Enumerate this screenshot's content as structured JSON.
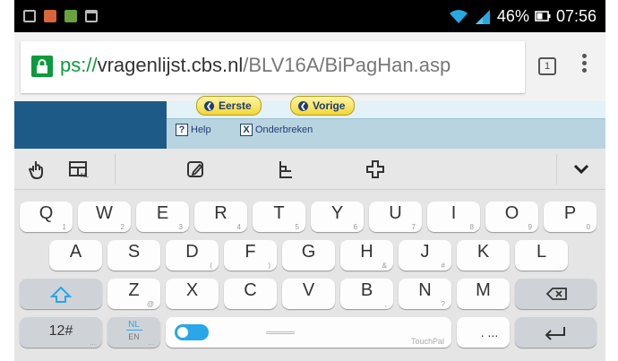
{
  "status_bar": {
    "battery_percent": "46%",
    "time": "07:56",
    "notification_icons": [
      "square-outline-icon",
      "app-orange-icon",
      "app-green-icon",
      "clipboard-icon"
    ]
  },
  "browser": {
    "url_scheme": "ps://",
    "url_host": "vragenlijst.cbs.nl",
    "url_path": "/BLV16A/BiPagHan.asp",
    "tab_count": "1"
  },
  "web": {
    "nav_buttons": [
      {
        "label": "Eerste"
      },
      {
        "label": "Vorige"
      }
    ],
    "links": [
      {
        "icon_text": "?",
        "label": "Help"
      },
      {
        "icon_text": "X",
        "label": "Onderbreken"
      }
    ]
  },
  "keyboard": {
    "toolbar_icons": [
      "touch-gesture-icon",
      "keyboard-layout-icon",
      "edit-icon",
      "cursor-select-icon",
      "move-icon",
      "collapse-chevron-icon"
    ],
    "layout_badge": "NL",
    "row1": [
      {
        "ch": "Q",
        "hint": "1"
      },
      {
        "ch": "W",
        "hint": "2"
      },
      {
        "ch": "E",
        "hint": "3"
      },
      {
        "ch": "R",
        "hint": "4"
      },
      {
        "ch": "T",
        "hint": "5"
      },
      {
        "ch": "Y",
        "hint": "6"
      },
      {
        "ch": "U",
        "hint": "7"
      },
      {
        "ch": "I",
        "hint": "8"
      },
      {
        "ch": "O",
        "hint": "9"
      },
      {
        "ch": "P",
        "hint": "0"
      }
    ],
    "row2": [
      {
        "ch": "A",
        "hint": ""
      },
      {
        "ch": "S",
        "hint": ""
      },
      {
        "ch": "D",
        "hint": "("
      },
      {
        "ch": "F",
        "hint": ")"
      },
      {
        "ch": "G",
        "hint": ""
      },
      {
        "ch": "H",
        "hint": "&"
      },
      {
        "ch": "J",
        "hint": "#"
      },
      {
        "ch": "K",
        "hint": ""
      },
      {
        "ch": "L",
        "hint": "."
      }
    ],
    "row3": [
      {
        "ch": "Z",
        "hint": "@"
      },
      {
        "ch": "X",
        "hint": ""
      },
      {
        "ch": "C",
        "hint": ""
      },
      {
        "ch": "V",
        "hint": ""
      },
      {
        "ch": "B",
        "hint": ","
      },
      {
        "ch": "N",
        "hint": "?"
      },
      {
        "ch": "M",
        "hint": ""
      }
    ],
    "numbers_key": "12#",
    "numbers_key_hint": "...",
    "language_key_top": "NL",
    "language_key_bottom": "EN",
    "language_key_hint": "...",
    "space_brand": "TouchPal",
    "period_key": ". ...",
    "accent_color": "#28a7e9"
  }
}
